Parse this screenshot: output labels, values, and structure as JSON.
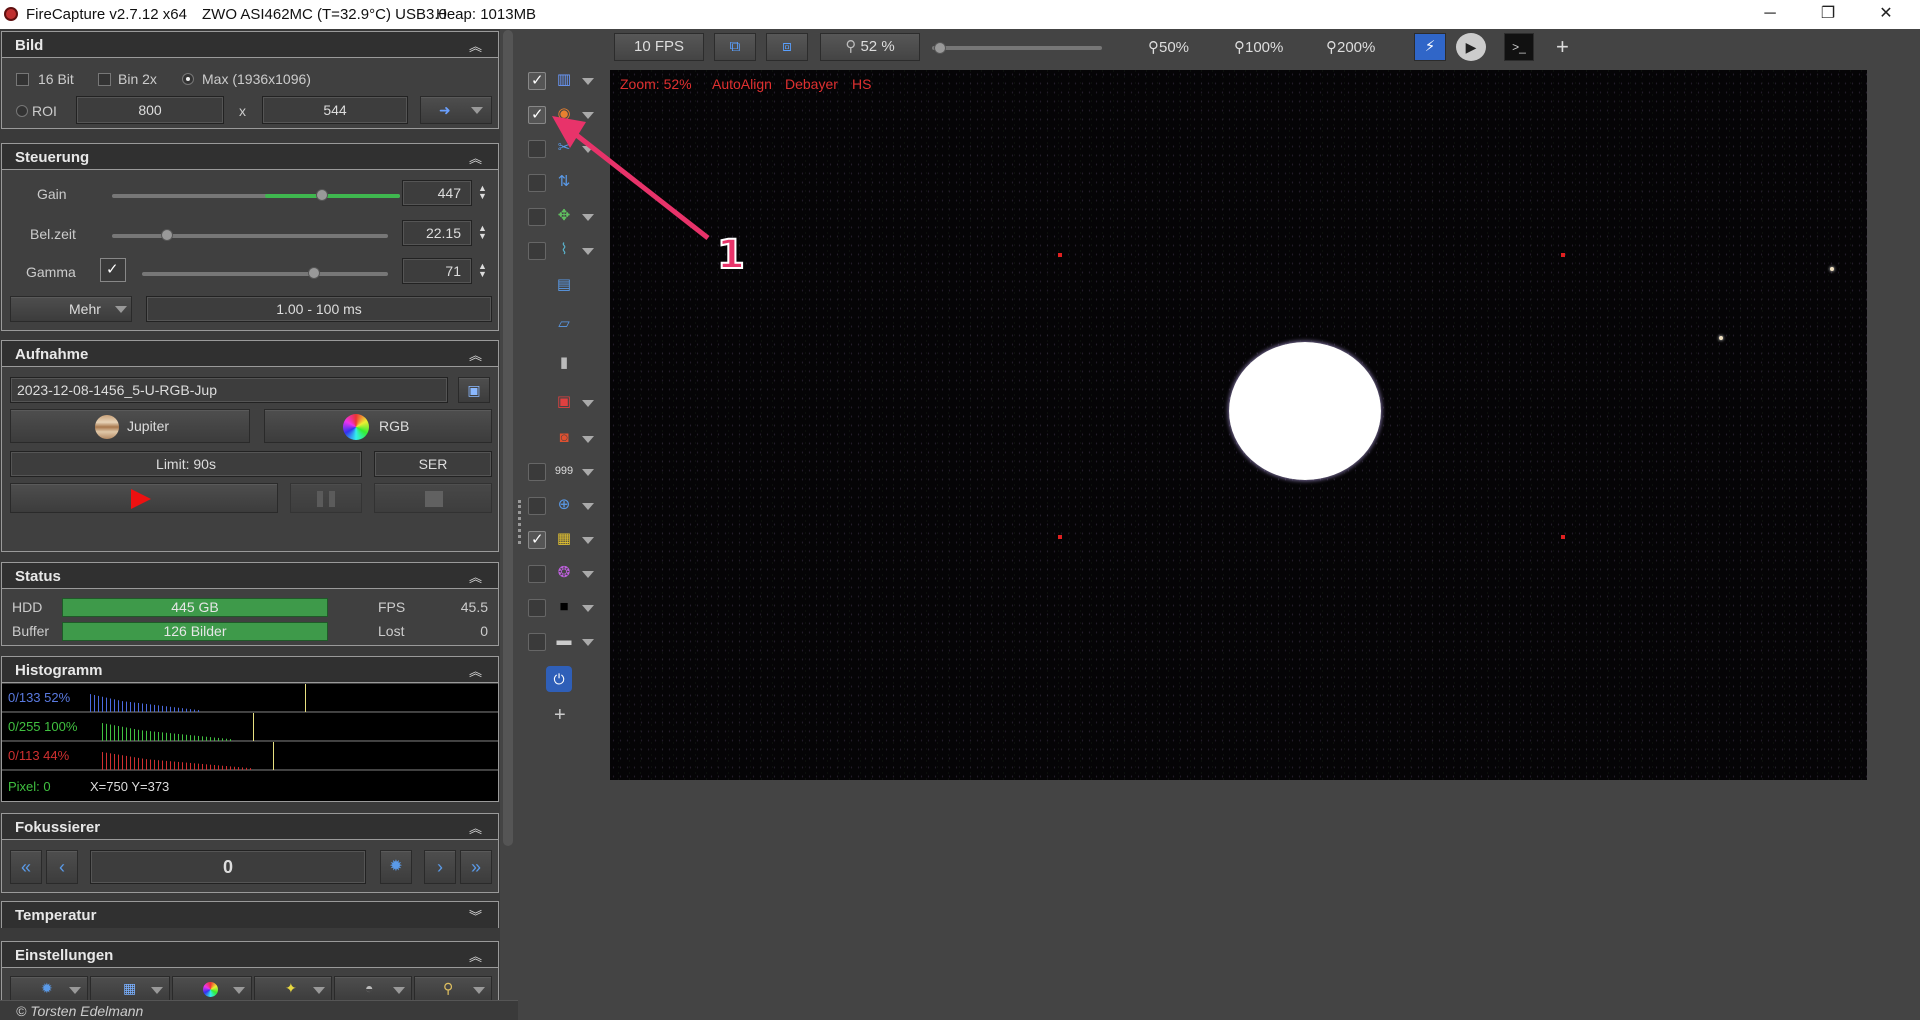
{
  "titlebar": {
    "app": "FireCapture v2.7.12 x64",
    "camera": "ZWO ASI462MC (T=32.9°C) USB3.0",
    "heap": "Heap: 1013MB",
    "minimize": "─",
    "restore": "❐",
    "close": "✕"
  },
  "bild": {
    "title": "Bild",
    "bit16": "16 Bit",
    "bin2x": "Bin 2x",
    "max": "Max (1936x1096)",
    "roi": "ROI",
    "roi_w": "800",
    "x": "x",
    "roi_h": "544"
  },
  "steuerung": {
    "title": "Steuerung",
    "gain_label": "Gain",
    "gain_value": "447",
    "gain_level": 0.73,
    "exp_label": "Bel.zeit",
    "exp_value": "22.15",
    "exp_level": 0.2,
    "gamma_label": "Gamma",
    "gamma_value": "71",
    "gamma_level": 0.7,
    "mehr": "Mehr",
    "range": "1.00 - 100 ms"
  },
  "aufnahme": {
    "title": "Aufnahme",
    "filename": "2023-12-08-1456_5-U-RGB-Jup",
    "target": "Jupiter",
    "filter": "RGB",
    "limit": "Limit: 90s",
    "format": "SER"
  },
  "status": {
    "title": "Status",
    "hdd_label": "HDD",
    "hdd_value": "445 GB",
    "fps_label": "FPS",
    "fps_value": "45.5",
    "buffer_label": "Buffer",
    "buffer_value": "126 Bilder",
    "lost_label": "Lost",
    "lost_value": "0"
  },
  "histogramm": {
    "title": "Histogramm",
    "blue": "0/133 52%",
    "green": "0/255 100%",
    "red": "0/113 44%",
    "pixel": "Pixel: 0",
    "coords": "X=750 Y=373"
  },
  "fokussierer": {
    "title": "Fokussierer",
    "position": "0"
  },
  "temperatur": {
    "title": "Temperatur"
  },
  "einstellungen": {
    "title": "Einstellungen"
  },
  "footer": "© Torsten Edelmann",
  "topbar": {
    "fps": "10 FPS",
    "zoom": "52 %",
    "z50": "50%",
    "z100": "100%",
    "z200": "200%",
    "plus": "+"
  },
  "viewer": {
    "zoom": "Zoom: 52%",
    "autoalign": "AutoAlign",
    "debayer": "Debayer",
    "hs": "HS"
  },
  "annotation": "1",
  "toolcol": {
    "plus": "+"
  },
  "colors": {
    "accent_red": "#e03030",
    "bar_green": "#3e9a4a",
    "annotation": "#e8336a"
  }
}
